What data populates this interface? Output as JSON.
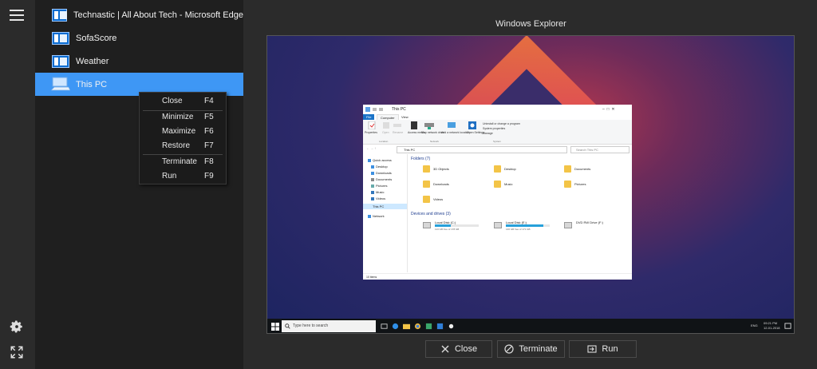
{
  "sidebar": {
    "items": [
      {
        "label": "Technastic | All About Tech - Microsoft Edge",
        "icon": "window-icon"
      },
      {
        "label": "SofaScore",
        "icon": "window-icon"
      },
      {
        "label": "Weather",
        "icon": "window-icon"
      },
      {
        "label": "This PC",
        "icon": "computer-icon",
        "selected": true
      }
    ],
    "colors": {
      "selected": "#3e97f5",
      "panel": "#1f1f1f",
      "rail": "#2b2b2b"
    }
  },
  "context_menu": {
    "items": [
      {
        "label": "Close",
        "shortcut": "F4"
      },
      {
        "label": "Minimize",
        "shortcut": "F5"
      },
      {
        "label": "Maximize",
        "shortcut": "F6"
      },
      {
        "label": "Restore",
        "shortcut": "F7"
      },
      {
        "label": "Terminate",
        "shortcut": "F8"
      },
      {
        "label": "Run",
        "shortcut": "F9"
      }
    ]
  },
  "preview": {
    "title": "Windows Explorer",
    "explorer": {
      "window_title": "This PC",
      "tabs": [
        "File",
        "Computer",
        "View"
      ],
      "ribbon": {
        "buttons": [
          "Properties",
          "Open",
          "Rename",
          "Access media",
          "Map network drive",
          "Add a network location",
          "Open Settings"
        ],
        "system_items": [
          "Uninstall or change a program",
          "System properties",
          "Manage"
        ],
        "groups": [
          "Location",
          "Network",
          "System"
        ]
      },
      "address": "This PC",
      "search_placeholder": "Search This PC",
      "nav": [
        "Quick access",
        "Desktop",
        "Downloads",
        "Documents",
        "Pictures",
        "Music",
        "Videos",
        "This PC",
        "Network"
      ],
      "folders_header": "Folders (7)",
      "folders": [
        "3D Objects",
        "Desktop",
        "Documents",
        "Downloads",
        "Music",
        "Pictures",
        "Videos"
      ],
      "drives_header": "Devices and drives (3)",
      "drives": [
        {
          "name": "Local Disk (C:)",
          "free": "113 GB free of 178 GB",
          "used": 0.37
        },
        {
          "name": "Local Disk (E:)",
          "free": "146 GB free of 171 GB",
          "used": 0.85
        },
        {
          "name": "DVD RW Drive (F:)",
          "free": "",
          "used": null
        }
      ],
      "status": "10 items"
    },
    "taskbar": {
      "search_placeholder": "Type here to search",
      "language": "ENG",
      "time": "09:21 PM",
      "date": "12-01-2018"
    }
  },
  "actions": {
    "close": "Close",
    "terminate": "Terminate",
    "run": "Run"
  }
}
